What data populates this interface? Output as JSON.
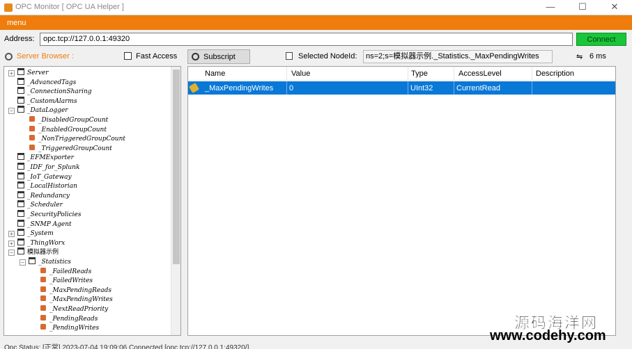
{
  "window": {
    "title": "OPC Monitor [ OPC UA Helper ]",
    "min_glyph": "—",
    "max_glyph": "☐",
    "close_glyph": "✕"
  },
  "menu": {
    "label": "menu"
  },
  "address": {
    "label": "Address:",
    "value": "opc.tcp://127.0.0.1:49320",
    "connect_label": "Connect"
  },
  "toolbar": {
    "server_browser_label": "Server Browser :",
    "fast_access_label": "Fast Access",
    "subscript_label": "Subscript",
    "selected_nodeid_label": "Selected NodeId:",
    "selected_nodeid_value": "ns=2;s=模拟器示例._Statistics._MaxPendingWrites",
    "latency_icon": "⇋",
    "latency_value": "6 ms"
  },
  "tree": {
    "items": [
      {
        "label": "Server",
        "expander": "+",
        "icon": "folder"
      },
      {
        "label": "_AdvancedTags",
        "expander": "",
        "icon": "folder"
      },
      {
        "label": "_ConnectionSharing",
        "expander": "",
        "icon": "folder"
      },
      {
        "label": "_CustomAlarms",
        "expander": "",
        "icon": "folder"
      },
      {
        "label": "_DataLogger",
        "expander": "−",
        "icon": "folder"
      },
      {
        "label": "_DisabledGroupCount",
        "expander": "",
        "icon": "tag"
      },
      {
        "label": "_EnabledGroupCount",
        "expander": "",
        "icon": "tag"
      },
      {
        "label": "_NonTriggeredGroupCount",
        "expander": "",
        "icon": "tag"
      },
      {
        "label": "_TriggeredGroupCount",
        "expander": "",
        "icon": "tag"
      },
      {
        "label": "_EFMExporter",
        "expander": "",
        "icon": "folder"
      },
      {
        "label": "_IDF_for_Splunk",
        "expander": "",
        "icon": "folder"
      },
      {
        "label": "_IoT_Gateway",
        "expander": "",
        "icon": "folder"
      },
      {
        "label": "_LocalHistorian",
        "expander": "",
        "icon": "folder"
      },
      {
        "label": "_Redundancy",
        "expander": "",
        "icon": "folder"
      },
      {
        "label": "_Scheduler",
        "expander": "",
        "icon": "folder"
      },
      {
        "label": "_SecurityPolicies",
        "expander": "",
        "icon": "folder"
      },
      {
        "label": "_SNMP Agent",
        "expander": "",
        "icon": "folder"
      },
      {
        "label": "_System",
        "expander": "+",
        "icon": "folder"
      },
      {
        "label": "_ThingWorx",
        "expander": "+",
        "icon": "folder"
      },
      {
        "label": "模拟器示例",
        "expander": "−",
        "icon": "folder"
      },
      {
        "label": "_Statistics",
        "expander": "−",
        "icon": "folder"
      },
      {
        "label": "_FailedReads",
        "expander": "",
        "icon": "tag"
      },
      {
        "label": "_FailedWrites",
        "expander": "",
        "icon": "tag"
      },
      {
        "label": "_MaxPendingReads",
        "expander": "",
        "icon": "tag"
      },
      {
        "label": "_MaxPendingWrites",
        "expander": "",
        "icon": "tag"
      },
      {
        "label": "_NextReadPriority",
        "expander": "",
        "icon": "tag"
      },
      {
        "label": "_PendingReads",
        "expander": "",
        "icon": "tag"
      },
      {
        "label": "_PendingWrites",
        "expander": "",
        "icon": "tag"
      }
    ]
  },
  "grid": {
    "columns": [
      "Name",
      "Value",
      "Type",
      "AccessLevel",
      "Description"
    ],
    "rows": [
      {
        "name": "_MaxPendingWrites",
        "value": "0",
        "type": "UInt32",
        "access": "CurrentRead",
        "description": ""
      }
    ]
  },
  "status": {
    "text": "Opc Status:    [正常]  2023-07-04 19:09:06  Connected [opc.tcp://127.0.0.1:49320/]"
  },
  "watermark": {
    "text": "源码海洋网",
    "url": "www.codehy.com"
  },
  "colors": {
    "accent": "#ee7d0d",
    "connect": "#19c63a",
    "selection": "#0a78d7"
  }
}
